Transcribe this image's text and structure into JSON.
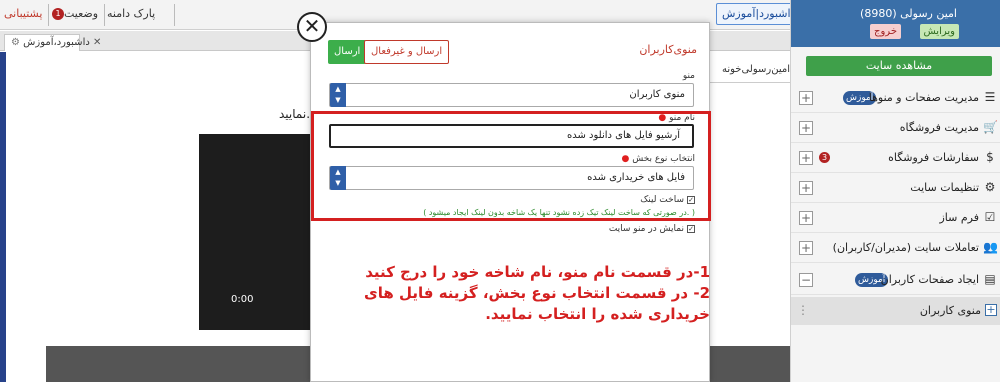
{
  "topbar": {
    "support": "پشتیبانی",
    "status": "وضعیت",
    "status_badge": "1",
    "park": "پارک دامنه",
    "dashboard_button": "داشبورد|آموزش"
  },
  "tab": {
    "label": "داشبورد،آموزش"
  },
  "content": {
    "breadcrumb": "امین‌رسولی‌خونه",
    "body_text": "نمایید.",
    "video_time": "0:00"
  },
  "sidebar": {
    "user_name": "امین رسولی (8980)",
    "edit_label": "ویرایش",
    "exit_label": "خروج",
    "view_site_label": "مشاهده سایت",
    "items": [
      {
        "label": "مدیریت صفحات و منوها",
        "badge": "آموزش",
        "icon": "list-icon"
      },
      {
        "label": "مدیریت فروشگاه",
        "icon": "cart-icon"
      },
      {
        "label": "سفارشات فروشگاه",
        "badge_count": "3",
        "icon": "dollar-icon"
      },
      {
        "label": "تنظیمات سایت",
        "icon": "gear-icon"
      },
      {
        "label": "فرم ساز",
        "icon": "check-icon"
      },
      {
        "label": "تعاملات سایت (مدیران/کاربران)",
        "icon": "users-icon"
      },
      {
        "label": "ایجاد صفحات کاربران",
        "badge": "آموزش",
        "icon": "doc-icon"
      }
    ],
    "sub_item": "منوی کاربران"
  },
  "modal": {
    "title": "منوی‌کاربران",
    "send_label": "ارسال",
    "send_inactive_label": "ارسال و غیرفعال",
    "menu_label": "منو",
    "menu_value": "منوی کاربران",
    "name_label": "نام منو",
    "name_value": "آرشیو فایل های دانلود شده",
    "section_label": "انتخاب نوع بخش",
    "section_value": "فایل های خریداری شده",
    "make_link_label": "ساخت لینک",
    "hint": "( در صورتی که ساخت لینک تیک زده نشود تنها یک شاخه بدون لینک ایجاد میشود. )",
    "show_in_menu_label": "نمایش در منو سایت"
  },
  "instructions": {
    "line1": "1-در قسمت نام منو، نام شاخه خود را درج کنید",
    "line2": "2- در قسمت انتخاب نوع بخش، گزینه فایل های خریداری شده را انتخاب نمایید."
  },
  "colors": {
    "accent_blue": "#3a6fa8",
    "green": "#3cae4b",
    "highlight_red": "#d42020"
  }
}
